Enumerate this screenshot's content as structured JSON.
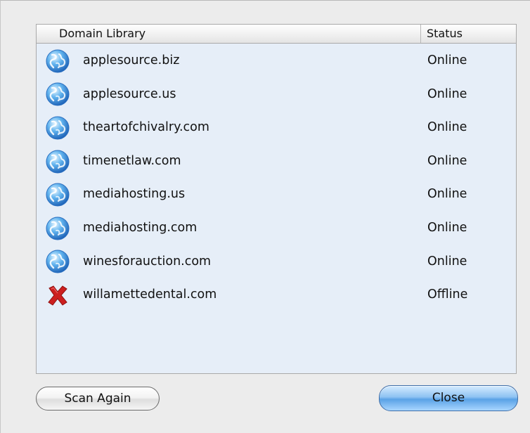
{
  "table": {
    "header_domain": "Domain Library",
    "header_status": "Status",
    "rows": [
      {
        "icon": "globe-icon",
        "domain": "applesource.biz",
        "status": "Online"
      },
      {
        "icon": "globe-icon",
        "domain": "applesource.us",
        "status": "Online"
      },
      {
        "icon": "globe-icon",
        "domain": "theartofchivalry.com",
        "status": "Online"
      },
      {
        "icon": "globe-icon",
        "domain": "timenetlaw.com",
        "status": "Online"
      },
      {
        "icon": "globe-icon",
        "domain": "mediahosting.us",
        "status": "Online"
      },
      {
        "icon": "globe-icon",
        "domain": "mediahosting.com",
        "status": "Online"
      },
      {
        "icon": "globe-icon",
        "domain": "winesforauction.com",
        "status": "Online"
      },
      {
        "icon": "red-x-icon",
        "domain": "willamettedental.com",
        "status": "Offline"
      }
    ]
  },
  "buttons": {
    "scan_again": "Scan Again",
    "close": "Close"
  },
  "colors": {
    "table_background": "#e6eef8",
    "close_button_blue": "#5aa2e6",
    "offline_red": "#cc1f1f"
  }
}
